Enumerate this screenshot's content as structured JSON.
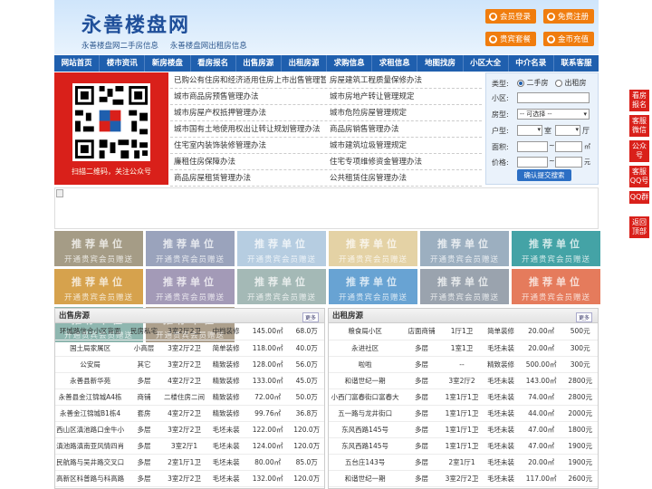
{
  "header": {
    "title": "永善楼盘网",
    "subtitles": [
      "永善楼盘网二手房信息",
      "永善楼盘网出租房信息"
    ],
    "buttons": [
      "会员登录",
      "免费注册",
      "贵宾套餐",
      "金币充值"
    ]
  },
  "nav": [
    "网站首页",
    "楼市资讯",
    "新房楼盘",
    "看房报名",
    "出售房源",
    "出租房源",
    "求购信息",
    "求租信息",
    "地图找房",
    "小区大全",
    "中介名录",
    "联系客服"
  ],
  "qr": {
    "caption": "扫描二维码，关注公众号"
  },
  "policy_links": [
    [
      "已购公有住房和经济适用住房上市出售管理暂",
      "房屋建筑工程质量保修办法"
    ],
    [
      "城市商品房预售管理办法",
      "城市房地产转让管理规定"
    ],
    [
      "城市房屋产权抵押管理办法",
      "城市危险房屋管理规定"
    ],
    [
      "城市国有土地使用权出让转让规划管理办法",
      "商品房销售管理办法"
    ],
    [
      "住宅室内装饰装修管理办法",
      "城市建筑垃圾管理规定"
    ],
    [
      "廉租住房保障办法",
      "住宅专项维修资金管理办法"
    ],
    [
      "商品房屋租赁管理办法",
      "公共租赁住房管理办法"
    ]
  ],
  "search": {
    "type_label": "类型:",
    "opt_sale": "二手房",
    "opt_rent": "出租房",
    "community_label": "小区:",
    "housetype_label": "房型:",
    "housetype_value": "-- 可选择 --",
    "layout_label": "户型:",
    "room_unit": "室",
    "hall_unit": "厅",
    "area_label": "面积:",
    "area_unit": "㎡",
    "price_label": "价格:",
    "price_unit": "元",
    "tilde": "~",
    "submit": "确认提交搜索"
  },
  "tiles": {
    "line1": "推荐单位",
    "line2": "开通贵宾会员赠送",
    "colors": [
      "#a59c86",
      "#9aa3bc",
      "#b6cde1",
      "#e4d2a5",
      "#9cafc0",
      "#44a3a6",
      "#d6a24d",
      "#a39ab7",
      "#a4b9b6",
      "#68a3d3",
      "#9aa3ae",
      "#e57b5c",
      "#8fb7b0",
      "#ada08d"
    ]
  },
  "sale": {
    "title": "出售房源",
    "more": "更多",
    "rows": [
      [
        "环城路信合小区背面",
        "民房私宅",
        "3室2厅2卫",
        "中档装修",
        "145.00㎡",
        "68.0万"
      ],
      [
        "国土局家属区",
        "小高层",
        "3室2厅2卫",
        "简单装修",
        "118.00㎡",
        "40.0万"
      ],
      [
        "公安局",
        "其它",
        "3室2厅2卫",
        "精致装修",
        "128.00㎡",
        "56.0万"
      ],
      [
        "永善县新华苑",
        "多层",
        "4室2厅2卫",
        "精致装修",
        "133.00㎡",
        "45.0万"
      ],
      [
        "永善县金江锦城A4栋",
        "商铺",
        "二楼住房二间",
        "精致装修",
        "72.00㎡",
        "50.0万"
      ],
      [
        "永善金江锦城B1栋4",
        "套房",
        "4室2厅2卫",
        "精致装修",
        "99.76㎡",
        "36.8万"
      ],
      [
        "西山区滇池路口金牛小",
        "多层",
        "3室2厅2卫",
        "毛坯未装",
        "122.00㎡",
        "120.0万"
      ],
      [
        "滇池路滇南亚风情四肖",
        "多层",
        "3室2厅1",
        "毛坯未装",
        "124.00㎡",
        "120.0万"
      ],
      [
        "民航路与吴井路交叉口",
        "多层",
        "2室1厅1卫",
        "毛坯未装",
        "80.00㎡",
        "85.0万"
      ],
      [
        "高新区科普路与科高路",
        "多层",
        "3室2厅2卫",
        "毛坯未装",
        "132.00㎡",
        "120.0万"
      ]
    ]
  },
  "rent": {
    "title": "出租房源",
    "more": "更多",
    "rows": [
      [
        "粮食局小区",
        "店面商铺",
        "1厅1卫",
        "简单装修",
        "20.00㎡",
        "500元"
      ],
      [
        "永进社区",
        "多层",
        "1室1卫",
        "毛坯未装",
        "20.00㎡",
        "300元"
      ],
      [
        "啦啦",
        "多层",
        "--",
        "精致装修",
        "500.00㎡",
        "300元"
      ],
      [
        "和谐世纪一期",
        "多层",
        "3室2厅2",
        "毛坯未装",
        "143.00㎡",
        "2800元"
      ],
      [
        "小西门富春街口富春大",
        "多层",
        "1室1厅1卫",
        "毛坯未装",
        "74.00㎡",
        "2800元"
      ],
      [
        "五一路与龙井街口",
        "多层",
        "1室1厅1卫",
        "毛坯未装",
        "44.00㎡",
        "2000元"
      ],
      [
        "东风西路145号",
        "多层",
        "1室1厅1卫",
        "毛坯未装",
        "47.00㎡",
        "1800元"
      ],
      [
        "东风西路145号",
        "多层",
        "1室1厅1卫",
        "毛坯未装",
        "47.00㎡",
        "1900元"
      ],
      [
        "五台庄143号",
        "多层",
        "2室1厅1",
        "毛坯未装",
        "20.00㎡",
        "1900元"
      ],
      [
        "和谐世纪一期",
        "多层",
        "3室2厅2卫",
        "毛坯未装",
        "117.00㎡",
        "2600元"
      ]
    ]
  },
  "float": [
    "看房报名",
    "客服微信",
    "公众号",
    "客服QQ号",
    "QQ群",
    "返回顶部"
  ]
}
